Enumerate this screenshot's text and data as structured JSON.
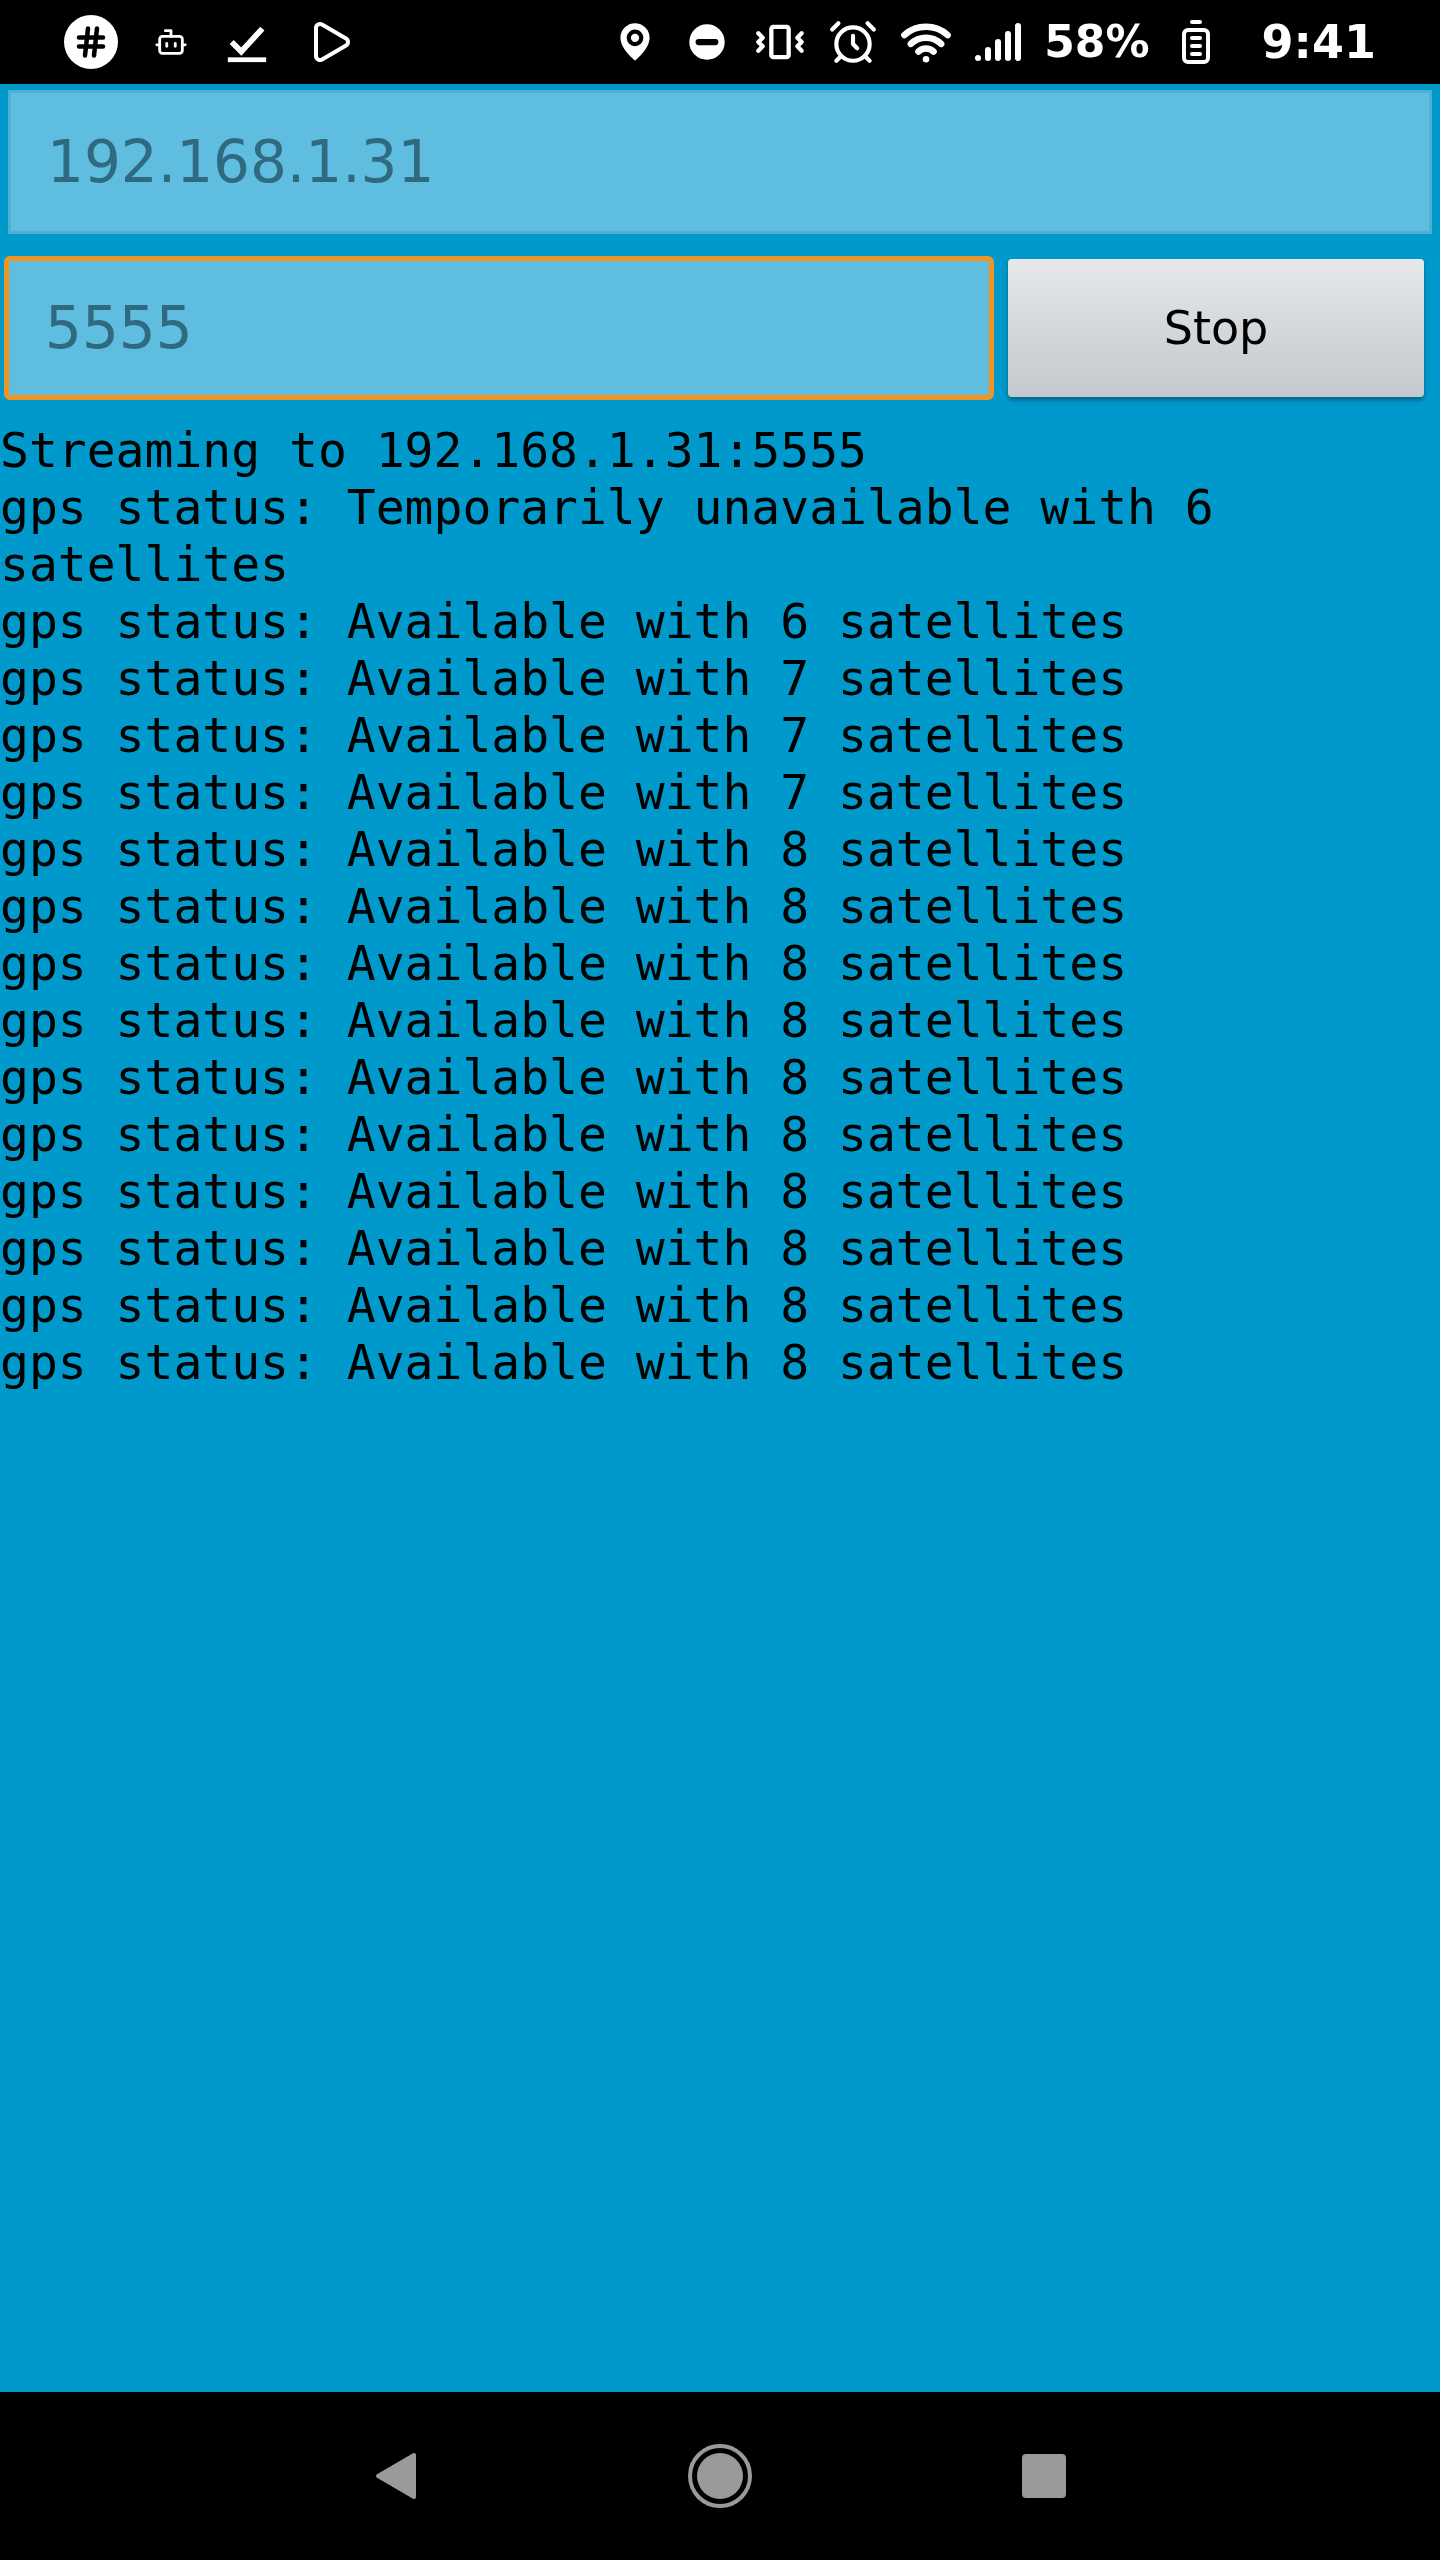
{
  "status_bar": {
    "battery": "58%",
    "time": "9:41"
  },
  "fields": [
    {
      "value": "192.168.1.31",
      "focused": false
    },
    {
      "value": "5555",
      "focused": true
    }
  ],
  "button": {
    "label": "Stop"
  },
  "log": [
    "Streaming to 192.168.1.31:5555",
    "gps status: Temporarily unavailable with 6 satellites",
    "gps status: Available with 6 satellites",
    "gps status: Available with 7 satellites",
    "gps status: Available with 7 satellites",
    "gps status: Available with 7 satellites",
    "gps status: Available with 8 satellites",
    "gps status: Available with 8 satellites",
    "gps status: Available with 8 satellites",
    "gps status: Available with 8 satellites",
    "gps status: Available with 8 satellites",
    "gps status: Available with 8 satellites",
    "gps status: Available with 8 satellites",
    "gps status: Available with 8 satellites",
    "gps status: Available with 8 satellites",
    "gps status: Available with 8 satellites"
  ]
}
